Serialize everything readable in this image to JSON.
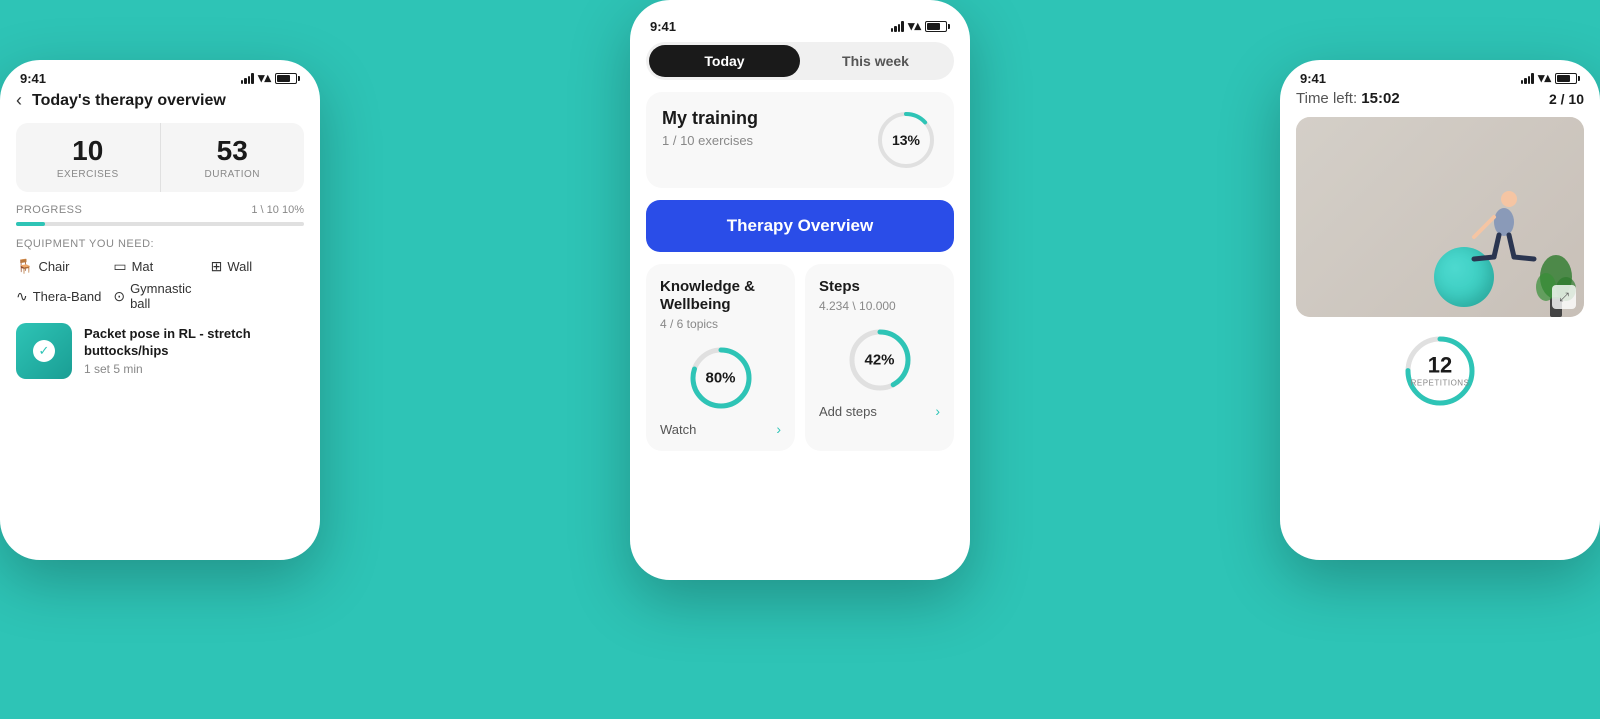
{
  "background_color": "#2ec4b6",
  "left_phone": {
    "status_time": "9:41",
    "header": {
      "back_label": "‹",
      "title": "Today's therapy overview"
    },
    "stats": {
      "exercises_number": "10",
      "exercises_label": "EXERCISES",
      "duration_number": "53",
      "duration_label": "DURATION"
    },
    "progress": {
      "title": "PROGRESS",
      "value": "1 \\ 10",
      "percent": "10%",
      "fill_width": "10%"
    },
    "equipment": {
      "title": "EQUIPMENT YOU NEED:",
      "items": [
        "Chair",
        "Mat",
        "Wall",
        "Thera-Band",
        "Gymnastic ball"
      ]
    },
    "exercise": {
      "name": "Packet pose in RL - stretch buttocks/hips",
      "meta": "1 set  5 min"
    }
  },
  "center_phone": {
    "status_time": "9:41",
    "tabs": {
      "today": "Today",
      "this_week": "This week"
    },
    "training": {
      "title": "My training",
      "subtitle": "1 / 10 exercises",
      "percent": "13%",
      "percent_value": 13
    },
    "therapy_button": "Therapy Overview",
    "knowledge": {
      "title": "Knowledge & Wellbeing",
      "subtitle": "4 / 6 topics",
      "percent": "80%",
      "percent_value": 80,
      "action": "Watch"
    },
    "steps": {
      "title": "Steps",
      "subtitle": "4.234 \\ 10.000",
      "percent": "42%",
      "percent_value": 42,
      "action": "Add steps"
    }
  },
  "right_phone": {
    "status_time": "9:41",
    "time_left_label": "Time left:",
    "time_left_value": "15:02",
    "exercise_counter": "2 / 10",
    "repetitions_number": "12",
    "repetitions_label": "REPETITIONS"
  },
  "icons": {
    "back": "‹",
    "check": "✓",
    "arrow_right": "›",
    "expand": "⤢",
    "signal": "signal",
    "wifi": "wifi",
    "battery": "battery"
  }
}
